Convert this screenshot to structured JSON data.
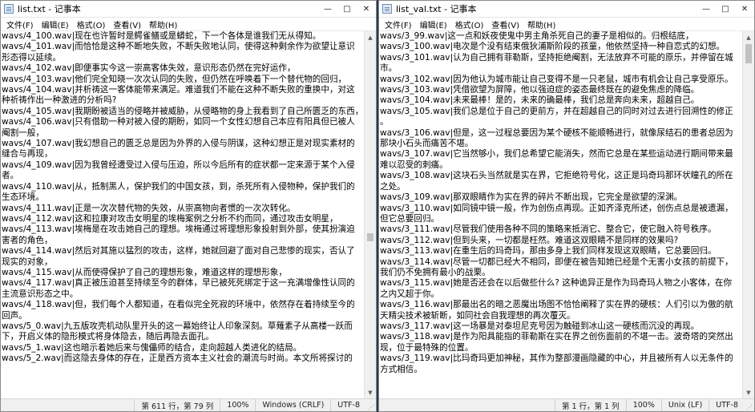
{
  "left": {
    "title": "list.txt - 记事本",
    "menu": [
      "文件(F)",
      "编辑(E)",
      "格式(O)",
      "查看(V)",
      "帮助(H)"
    ],
    "lines": [
      "wavs/4_100.wav|现在也许暂时是鳄雀鳝或是蟒蛇，下一个各体是谁我们无从得知。",
      "wavs/4_101.wav|而恰恰是这种不断地失败，不断失败地认同，使得这种剩余作为欲望让意识",
      "形态得以延续。",
      "wavs/4_102.wav|即便事实今这一崇高客体失效，意识形态仍然在完好运作，",
      "wavs/4_103.wav|他们完全知晓一次次认同的失败，但仍然在呼唤着下一个替代物的回归，",
      "wavs/4_104.wav|并析祷这一客体能带来满足。难道我们不能在这种不断失败的重换中，对这",
      "种祈祷作出一种激进的分析吗?",
      "wavs/4_105.wav|我期盼被适当的侵略并被威胁，从侵略物的身上我看到了自己所匮乏的东西，",
      "wavs/4_106.wav|只有借助一种对被入侵的期盼，如同一个女性幻想自己本应有阳具但已被人",
      "阉割一般，",
      "wavs/4_107.wav|我幻想自己的匮乏总是因为外界的入侵与阴谋，这种幻想正是对现实素材的",
      "缝合与再现，",
      "wavs/4_109.wav|因为我曾经遭受过入侵与压迫，所以今后所有的症状都一定来源于某个入侵",
      "者。",
      "wavs/4_110.wav|从，抵制黑人，保护我们的中国女孩，到，杀死所有入侵物种，保护我们的",
      "生态环境。",
      "wavs/4_111.wav|正是一次次替代物的失效，从崇高物向者惯的一次次转化。",
      "wavs/4_112.wav|这和拉康对攻击女明星的埃梅案例之分析不约而同，通过攻击女明星，",
      "wavs/4_113.wav|埃梅是在攻击她自己的理想。埃梅通过将理想形象投射到外部，使其扮演迫",
      "害者的角色，",
      "wavs/4_114.wav|然后对其施以猛烈的攻击，这样，她就回避了面对自己悲惨的现实，否认了",
      "现实的对象，",
      "wavs/4_115.wav|从而使得保护了自己的理想形象，难道这样的理想形象，",
      "wavs/4_117.wav|真正被压迫甚至持续至今的群体，早已被死死绑定于这一充满增像性认同的",
      "主流意识形态之中。",
      "wavs/4_118.wav|但，我们每个人都知道，在看似完全死寂的环境中，依然存在着持续至今的",
      "回声。",
      "wavs/5_0.wav|九五版攻壳机动队里开头的这一幕始终让人印象深刻。草薙素子从高楼一跃而",
      "下，开启义体的隐形模式将身体隐去，随后再隐去面孔。",
      "wavs/5_1.wav|这也暗示着她后来与傀儡师的结合，走向超越人类进化的结局。",
      "wavs/5_2.wav|而这隐去身体的存在，正是西方资本主义社会的潮流与时尚。本文所将探讨的"
    ],
    "status": {
      "position": "第 611 行，第 79 列",
      "zoom": "100%",
      "eol": "Windows (CRLF)",
      "encoding": "UTF-8"
    }
  },
  "right": {
    "title": "list_val.txt - 记事本",
    "menu": [
      "文件(F)",
      "编辑(E)",
      "格式(O)",
      "查看(V)",
      "帮助(H)"
    ],
    "lines": [
      "wavs/3_99.wav|这一点和妖夜使鬼中男主角杀死自己的妻子是相似的。归根结底，",
      "wavs/3_100.wav|电次是个没有结束俄狄浦斯阶段的孩童，他依然坚持一种自恋式的幻想。",
      "wavs/3_101.wav|认为自己拥有菲勒斯，坚持拒绝阉割，无法放弃不可能的原乐，并停留在城",
      "市。",
      "wavs/3_102.wav|因为他认为城市能让自己变得不是一只老鼠，城市有机会让自己享受原乐。",
      "wavs/3_103.wav|凭借欲望为屏障，他以强迫症的姿态最终既在的避免焦虑的降临。",
      "wavs/3_104.wav|未来最棒！是的，未来的确最棒，我们总是奔向未来，超越自己。",
      "wavs/3_105.wav|我们总是位于自己的更前方，并在超越自己的同时对过去进行回溯性的修正",
      "。",
      "wavs/3_106.wav|但是，这一过程总要因为某个硬核不能顺畅进行，就像尿结石的患者总因为",
      "那块小石头而痛苦不堪。",
      "wavs/3_107.wav|它当然够小，我们总希望它能消失，然而它总是在某些运动进行期间带来最",
      "难以忍受的刺痛。",
      "wavs/3_108.wav|这块石头当然就是实在界，它拒绝符号化，这正是玛奇玛那环状瞳孔的所在",
      "之处。",
      "wavs/3_109.wav|那双眼睛作为实在界的碎片不断出现，它完全是欲望的深渊。",
      "wavs/3_110.wav|如同镜中镜一般，作为创伤点再现。正如齐泽克所述，创伤点总是被遗漏，",
      "但它总要回归。",
      "wavs/3_111.wav|尽管我们使用各种不同的策略来抵消它、整合它，使它融入符号秩序。",
      "wavs/3_112.wav|但到头来，一切都是枉然。难道这双眼睛不是同样的效果吗?",
      "wavs/3_113.wav|在重生后的玛奇玛，那由多身上我们同样发现这双眼睛，它总要回归。",
      "wavs/3_114.wav|尽管一切都已经大不相同，即便在被告知她已经是个无害小女孩的前提下，",
      "我们仍不免拥有最小的战栗。",
      "wavs/3_115.wav|她是否还会在以后做些什么? 这种诡异正是作为玛奇玛人物之小客体，在你",
      "之内又超于你。",
      "wavs/3_116.wav|那最出名的暗之恶魔出场图不恰恰阐释了实在界的硬核：人们引以为傲的航",
      "天精尖技术被斩断，如同社会自我理想的再次覆灭。",
      "wavs/3_117.wav|这一场暴是对泰坦尼克号因为触碰到冰山这一硬核而沉没的再现。",
      "wavs/3_118.wav|是作为阳具能指的菲勒斯在实在界之创伤面前的不堪一击。波奇塔的突然出",
      "现，位于最特殊的位置。",
      "wavs/3_119.wav|比玛奇玛更加神秘，其作为整部漫画隐藏的中心，并且被所有人以无条件的",
      "方式相信。"
    ],
    "status": {
      "position": "第 1 行，第 1 列",
      "zoom": "100%",
      "eol": "Unix (LF)",
      "encoding": "UTF-8"
    }
  }
}
